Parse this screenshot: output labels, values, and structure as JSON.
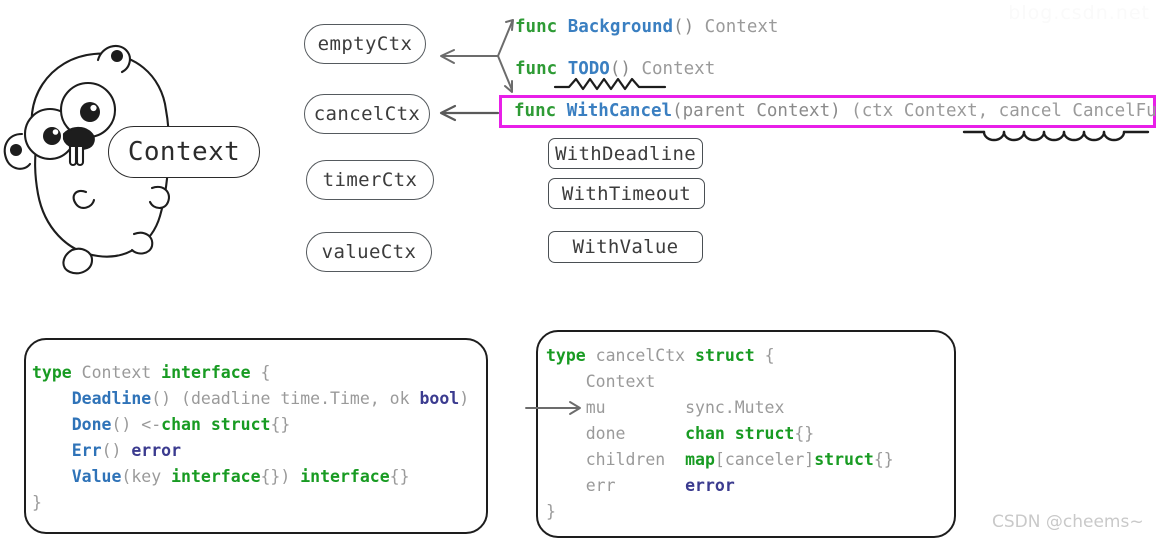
{
  "mascot": {
    "name": "go-gopher",
    "label": "Context"
  },
  "ctx_nodes": [
    {
      "id": "emptyCtx",
      "label": "emptyCtx"
    },
    {
      "id": "cancelCtx",
      "label": "cancelCtx"
    },
    {
      "id": "timerCtx",
      "label": "timerCtx"
    },
    {
      "id": "valueCtx",
      "label": "valueCtx"
    }
  ],
  "with_boxes": [
    {
      "id": "WithDeadline",
      "label": "WithDeadline"
    },
    {
      "id": "WithTimeout",
      "label": "WithTimeout"
    },
    {
      "id": "WithValue",
      "label": "WithValue"
    }
  ],
  "signatures": {
    "background": {
      "keyword": "func",
      "name": "Background",
      "params": "()",
      "returns": " Context"
    },
    "todo": {
      "keyword": "func",
      "name": "TODO",
      "params": "()",
      "returns": " Context",
      "underline": "zigzag"
    },
    "withcancel": {
      "keyword": "func",
      "name": "WithCancel",
      "params": "(parent Context)",
      "returns": " (ctx Context, cancel CancelFunc)",
      "underline": "scallop",
      "highlighted": true
    }
  },
  "code_context": {
    "title": "Context interface",
    "lines": [
      [
        {
          "t": "type",
          "c": "kw"
        },
        {
          "t": " Context ",
          "c": "gray"
        },
        {
          "t": "interface",
          "c": "kw"
        },
        {
          "t": " {",
          "c": "gray"
        }
      ],
      [
        {
          "t": "    ",
          "c": "gray"
        },
        {
          "t": "Deadline",
          "c": "fn"
        },
        {
          "t": "() (deadline time.Time, ok ",
          "c": "gray"
        },
        {
          "t": "bool",
          "c": "ty"
        },
        {
          "t": ")",
          "c": "gray"
        }
      ],
      [
        {
          "t": "    ",
          "c": "gray"
        },
        {
          "t": "Done",
          "c": "fn"
        },
        {
          "t": "() <-",
          "c": "gray"
        },
        {
          "t": "chan struct",
          "c": "kw"
        },
        {
          "t": "{}",
          "c": "gray"
        }
      ],
      [
        {
          "t": "    ",
          "c": "gray"
        },
        {
          "t": "Err",
          "c": "fn"
        },
        {
          "t": "() ",
          "c": "gray"
        },
        {
          "t": "error",
          "c": "ty"
        }
      ],
      [
        {
          "t": "    ",
          "c": "gray"
        },
        {
          "t": "Value",
          "c": "fn"
        },
        {
          "t": "(key ",
          "c": "gray"
        },
        {
          "t": "interface",
          "c": "kw"
        },
        {
          "t": "{}) ",
          "c": "gray"
        },
        {
          "t": "interface",
          "c": "kw"
        },
        {
          "t": "{}",
          "c": "gray"
        }
      ],
      [
        {
          "t": "}",
          "c": "gray"
        }
      ]
    ]
  },
  "code_cancelctx": {
    "title": "cancelCtx struct",
    "annotation_arrow_target": "mu",
    "lines": [
      [
        {
          "t": "type",
          "c": "kw"
        },
        {
          "t": " cancelCtx ",
          "c": "gray"
        },
        {
          "t": "struct",
          "c": "kw"
        },
        {
          "t": " {",
          "c": "gray"
        }
      ],
      [
        {
          "t": "    Context",
          "c": "gray"
        }
      ],
      [
        {
          "t": "    mu        sync.Mutex",
          "c": "gray"
        }
      ],
      [
        {
          "t": "    done      ",
          "c": "gray"
        },
        {
          "t": "chan struct",
          "c": "kw"
        },
        {
          "t": "{}",
          "c": "gray"
        }
      ],
      [
        {
          "t": "    children  ",
          "c": "gray"
        },
        {
          "t": "map",
          "c": "kw"
        },
        {
          "t": "[canceler]",
          "c": "gray"
        },
        {
          "t": "struct",
          "c": "kw"
        },
        {
          "t": "{}",
          "c": "gray"
        }
      ],
      [
        {
          "t": "    err       ",
          "c": "gray"
        },
        {
          "t": "error",
          "c": "ty"
        }
      ],
      [
        {
          "t": "}",
          "c": "gray"
        }
      ]
    ]
  },
  "watermarks": {
    "top_right": "blog.csdn.net",
    "bottom_right": "CSDN @cheems~"
  },
  "colors": {
    "keyword_green": "#189b22",
    "func_blue": "#2f73b8",
    "type_navy": "#3b3b8f",
    "plain_gray": "#9a9a9a",
    "highlight_magenta": "#e81fe8",
    "box_outline": "#1d1d1d"
  }
}
